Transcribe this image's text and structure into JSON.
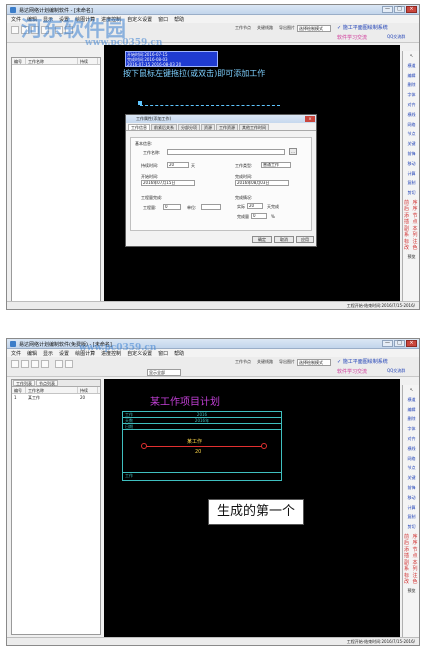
{
  "watermark": {
    "brand": "河东软件园",
    "url": "www.pc0359.cn"
  },
  "app": {
    "title_top": "易达网络计划编制软件 - [未命名]",
    "title_bottom": "易达网络计划编制软件(免费版) - [未命名]",
    "window_buttons": [
      "—",
      "□",
      "×"
    ]
  },
  "menu": [
    "文件",
    "编辑",
    "显示",
    "设置",
    "绘图计算",
    "进度控制",
    "自定义设置",
    "窗口",
    "帮助"
  ],
  "toolbar": {
    "left_buttons": [
      "新建",
      "打开",
      "保存",
      "打印",
      "撤销",
      "重做"
    ],
    "zoom_value": "显示全部",
    "right_labels": [
      "工作节点",
      "关键线路",
      "导出图片"
    ],
    "select_mode_label": "选择绘制模式",
    "notice_1": "✓ 施工平面图绘制系统",
    "notice_2": "软件学习交流",
    "qq_group": "QQ交流群"
  },
  "left_panel": {
    "tabs": [
      "工作列表",
      "节点列表"
    ],
    "columns": [
      "编号",
      "工作名称",
      "持续"
    ],
    "rows": [
      [
        "1",
        "某工作",
        "20"
      ]
    ]
  },
  "right_bar": {
    "items": [
      "选择",
      "横道",
      "编辑",
      "删除",
      "字体",
      "对齐",
      "横线",
      "网络",
      "节点",
      "关键",
      "前锋",
      "移动",
      "计算",
      "复制",
      "剪切",
      "粘贴",
      "属性",
      "打开"
    ],
    "red_items": [
      "前",
      "后",
      "添",
      "插",
      "副",
      "系",
      "标",
      "改"
    ],
    "red_items_2": [
      "序",
      "序",
      "节",
      "点",
      "本",
      "列",
      "注",
      "色"
    ],
    "last": "预览"
  },
  "shot1": {
    "hint": "按下鼠标左键拖拉(或双击)即可添加工作",
    "popup_lines": [
      "开始时间:2016-07-15",
      "完成时间:2016-08-03",
      "2016-07-15  2016-08-03   20"
    ],
    "dialog": {
      "title": "工作属性(添加工作)",
      "tabs": [
        "工作信息",
        "前紧后关系",
        "分部分项",
        "资源",
        "工作资源",
        "其他工作时间"
      ],
      "section_basic": "基本信息:",
      "name_label": "工作名称:",
      "name_value": "",
      "duration_label": "持续时间:",
      "duration_value": "20",
      "duration_unit": "天",
      "type_label": "工作类型:",
      "type_value": "普通工作",
      "start_label": "开始时间:",
      "start_value": "2016年07月15日",
      "finish_label": "完成时间:",
      "finish_value": "2016年08月03日",
      "progress_label": "完成情况:",
      "actual_label": "实际",
      "actual_value": "20",
      "actual_unit": "天完成",
      "ratio_label": "完成量",
      "ratio_value": "0",
      "ratio_unit": "%",
      "quantity_label": "工程量完成:",
      "quantity_sub": "工程量:",
      "quantity_value": "0",
      "unit_label": "单位:",
      "ok": "确定",
      "cancel": "取消",
      "apply": "应用"
    }
  },
  "shot2": {
    "zoom_label": "显示全部",
    "plan_title": "某工作项目计划",
    "header_year": "2016",
    "header_label": "2016年",
    "task_label": "某工作",
    "task_duration": "20",
    "row_labels": [
      "工作",
      "天数",
      "日期"
    ],
    "footer_left": "工作",
    "callout": "生成的第一个",
    "left_rows": [
      [
        "1",
        "某工作",
        "20"
      ]
    ]
  },
  "status": {
    "text_top": "工程开始-结束时间:2016/7/15-2016/",
    "text_bottom": "工程开始-结束时间:2016/7/15-2016/"
  },
  "colors": {
    "canvas_bg": "#000000",
    "accent_blue": "#1d3fb6",
    "accent_red": "#d12f2f",
    "plan_border": "#3fbfbf",
    "task_line": "#e23030",
    "title_magenta": "#c23fd6"
  }
}
